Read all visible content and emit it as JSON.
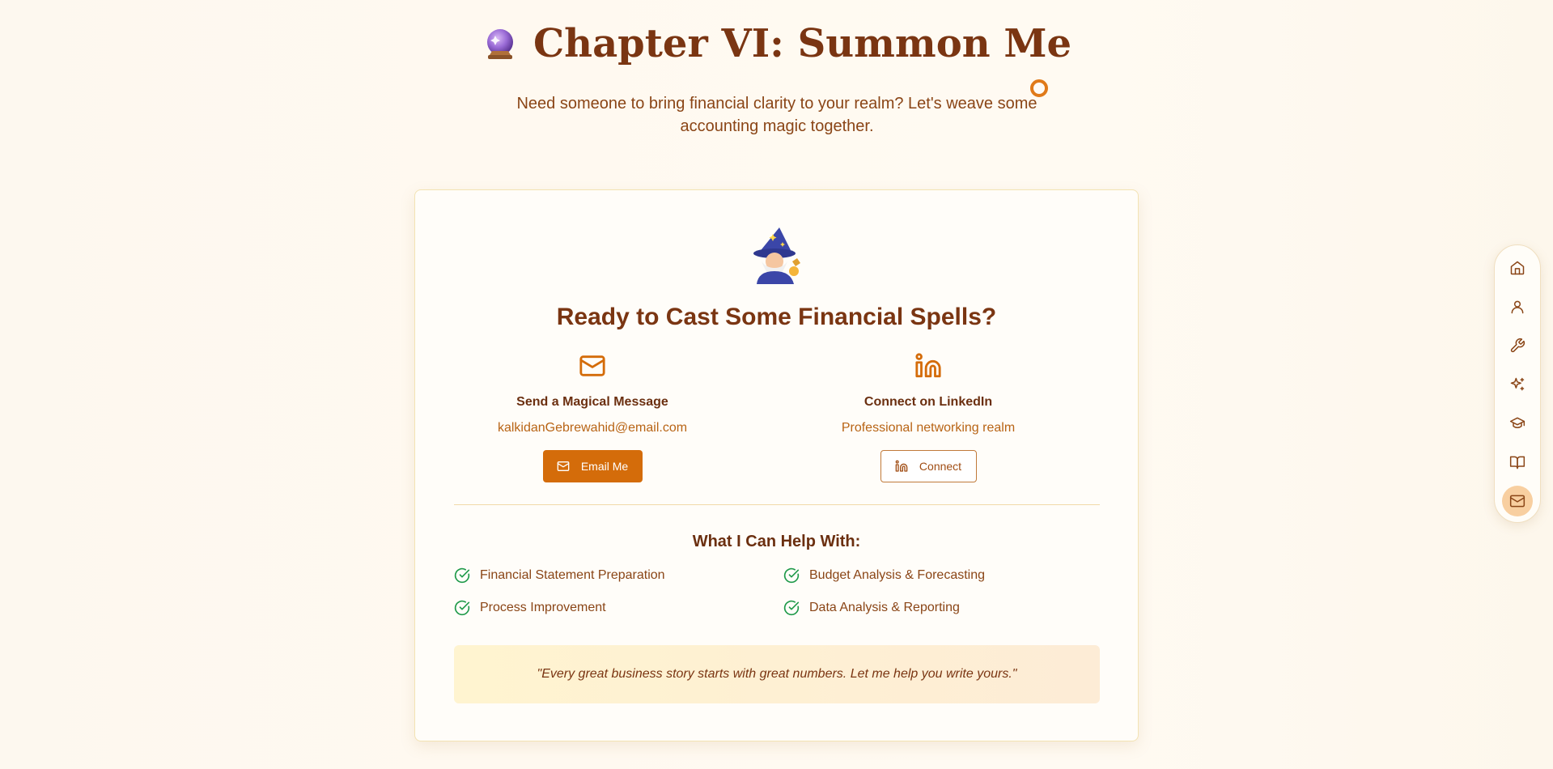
{
  "header": {
    "emoji": "🔮",
    "title": "Chapter VI: Summon Me",
    "subtitle": "Need someone to bring financial clarity to your realm? Let's weave some accounting magic together."
  },
  "card": {
    "emoji": "🧙‍♂️",
    "heading": "Ready to Cast Some Financial Spells?",
    "email": {
      "icon": "mail-icon",
      "title": "Send a Magical Message",
      "address": "kalkidanGebrewahid@email.com",
      "button_label": "Email Me"
    },
    "linkedin": {
      "icon": "linkedin-icon",
      "title": "Connect on LinkedIn",
      "subtitle": "Professional networking realm",
      "button_label": "Connect"
    },
    "help": {
      "heading": "What I Can Help With:",
      "items": [
        "Financial Statement Preparation",
        "Budget Analysis & Forecasting",
        "Process Improvement",
        "Data Analysis & Reporting"
      ]
    },
    "quote": "\"Every great business story starts with great numbers. Let me help you write yours.\""
  },
  "side_nav": {
    "items": [
      {
        "icon": "home-icon",
        "active": false
      },
      {
        "icon": "user-icon",
        "active": false
      },
      {
        "icon": "wrench-icon",
        "active": false
      },
      {
        "icon": "sparkles-icon",
        "active": false
      },
      {
        "icon": "graduation-cap-icon",
        "active": false
      },
      {
        "icon": "book-open-icon",
        "active": false
      },
      {
        "icon": "mail-icon",
        "active": true
      }
    ]
  },
  "colors": {
    "title": "#7a3512",
    "accent": "#d46c0a",
    "check": "#1f9a4a",
    "nav_active": "#f8cfa0"
  }
}
